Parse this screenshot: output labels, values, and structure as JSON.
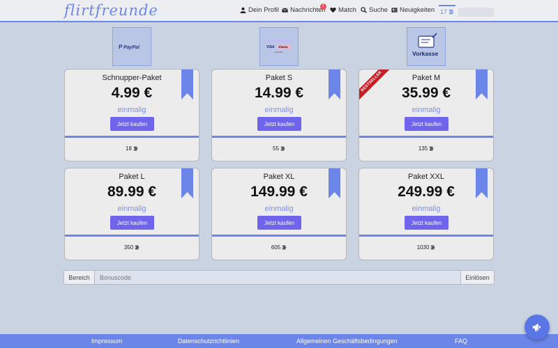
{
  "header": {
    "logo": "flirtfreunde",
    "nav": [
      {
        "label": "Dein Profil",
        "icon": "user-icon"
      },
      {
        "label": "Nachrichten",
        "icon": "envelope-icon",
        "badge": "1"
      },
      {
        "label": "Match",
        "icon": "heart-icon"
      },
      {
        "label": "Suche",
        "icon": "search-icon"
      },
      {
        "label": "Neuigkeiten",
        "icon": "news-icon"
      }
    ],
    "coins": "17"
  },
  "payment_methods": [
    {
      "name": "PayPal",
      "label": "PayPal"
    },
    {
      "name": "Klarna",
      "label_visa": "VISA",
      "label_klarna": "Klarna",
      "sub": "SOFORT"
    },
    {
      "name": "Vorkasse",
      "label": "Vorkasse"
    }
  ],
  "packages": [
    {
      "name": "Schnupper-Paket",
      "price": "4.99 €",
      "type": "einmalig",
      "button": "Jetzt kaufen",
      "coins": "18"
    },
    {
      "name": "Paket S",
      "price": "14.99 €",
      "type": "einmalig",
      "button": "Jetzt kaufen",
      "coins": "55"
    },
    {
      "name": "Paket M",
      "price": "35.99 €",
      "type": "einmalig",
      "button": "Jetzt kaufen",
      "coins": "135",
      "badge": "BESTSELLER"
    },
    {
      "name": "Paket L",
      "price": "89.99 €",
      "type": "einmalig",
      "button": "Jetzt kaufen",
      "coins": "350"
    },
    {
      "name": "Paket XL",
      "price": "149.99 €",
      "type": "einmalig",
      "button": "Jetzt kaufen",
      "coins": "605"
    },
    {
      "name": "Paket XXL",
      "price": "249.99 €",
      "type": "einmalig",
      "button": "Jetzt kaufen",
      "coins": "1030"
    }
  ],
  "bonus": {
    "label": "Bereich",
    "placeholder": "Bonuscode",
    "button": "Einlösen"
  },
  "footer": {
    "links": [
      "Impressum",
      "Datenschutzrichtlinien",
      "Allgemeinen Geschäftsbedingungen",
      "FAQ"
    ]
  },
  "colors": {
    "accent": "#6b86e8",
    "button": "#6f64ec",
    "bestseller": "#c81f27"
  }
}
